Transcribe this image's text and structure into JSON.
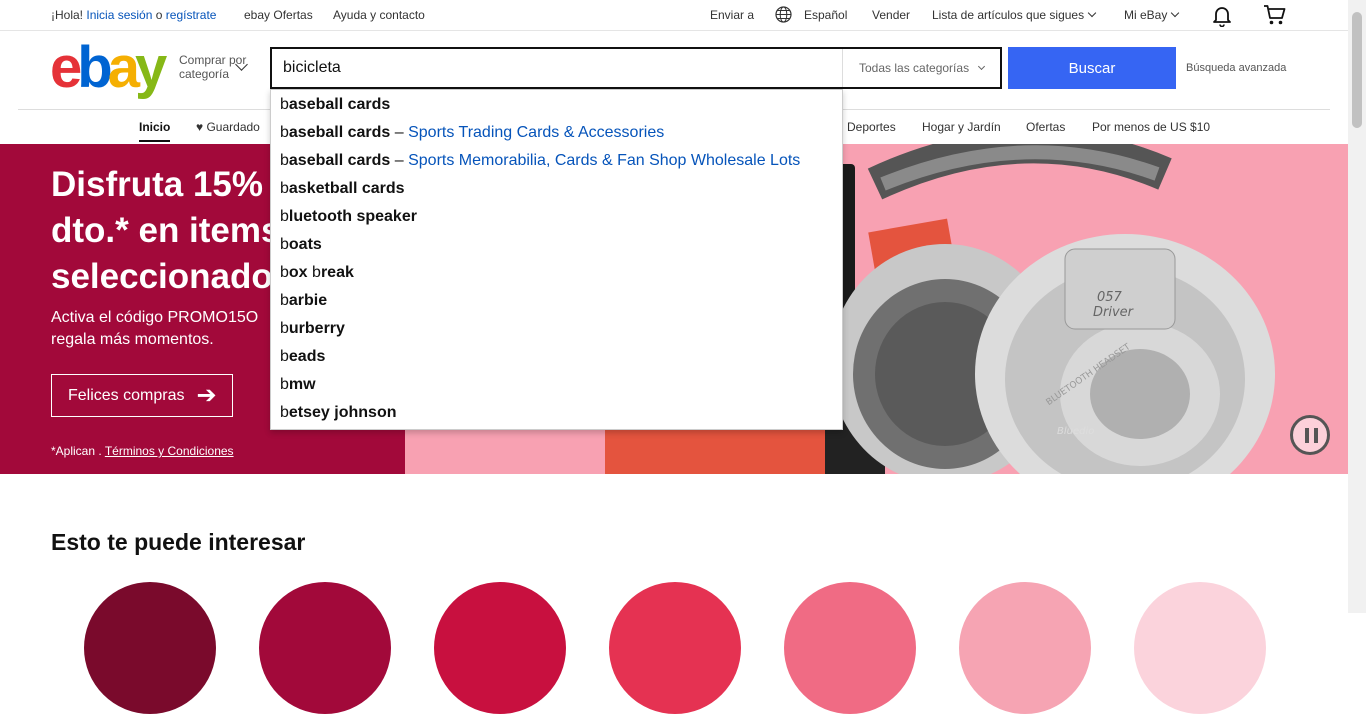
{
  "topbar": {
    "greeting": "¡Hola!",
    "signin": "Inicia sesión",
    "or": "o",
    "register": "regístrate",
    "deals": "ebay Ofertas",
    "help": "Ayuda y contacto",
    "ship_to": "Enviar a",
    "language": "Español",
    "sell": "Vender",
    "watchlist": "Lista de artículos que sigues",
    "my_ebay": "Mi eBay"
  },
  "header": {
    "shop_by_category": [
      "Comprar por",
      "categoría"
    ],
    "search_value": "bicicleta",
    "category_select": "Todas las categorías",
    "search_button": "Buscar",
    "advanced": "Búsqueda avanzada"
  },
  "nav": {
    "home": "Inicio",
    "saved": "Guardado",
    "items": [
      "Deportes",
      "Hogar y Jardín",
      "Ofertas",
      "Por menos de US $10"
    ]
  },
  "suggestions": [
    {
      "prefix": "b",
      "rest": "aseball cards",
      "sep": "",
      "category": ""
    },
    {
      "prefix": "b",
      "rest": "aseball cards",
      "sep": " – ",
      "category": "Sports Trading Cards & Accessories"
    },
    {
      "prefix": "b",
      "rest": "aseball cards",
      "sep": " – ",
      "category": "Sports Memorabilia, Cards & Fan Shop Wholesale Lots"
    },
    {
      "prefix": "b",
      "rest": "asketball cards",
      "sep": "",
      "category": ""
    },
    {
      "prefix": "b",
      "rest": "luetooth speaker",
      "sep": "",
      "category": ""
    },
    {
      "prefix": "b",
      "rest": "oats",
      "sep": "",
      "category": ""
    },
    {
      "prefix": "b",
      "rest": "ox ",
      "rest2_plain": "b",
      "rest3": "reak",
      "sep": "",
      "category": ""
    },
    {
      "prefix": "b",
      "rest": "arbie",
      "sep": "",
      "category": ""
    },
    {
      "prefix": "b",
      "rest": "urberry",
      "sep": "",
      "category": ""
    },
    {
      "prefix": "b",
      "rest": "eads",
      "sep": "",
      "category": ""
    },
    {
      "prefix": "b",
      "rest": "mw",
      "sep": "",
      "category": ""
    },
    {
      "prefix": "b",
      "rest": "etsey johnson",
      "sep": "",
      "category": ""
    }
  ],
  "hero": {
    "title_lines": [
      "Disfruta 15%",
      "dto.* en items",
      "seleccionado"
    ],
    "subtitle_lines": [
      "Activa el código PROMO15O",
      "regala más momentos."
    ],
    "button": "Felices compras",
    "terms_prefix": "*Aplican .",
    "terms_link": "Términos y Condiciones",
    "headphone_text": [
      "057",
      "Driver"
    ],
    "headphone_brand": "Bluedio",
    "headphone_band_text": "BLUETOOTH HEADSET"
  },
  "section": {
    "title": "Esto te puede interesar"
  },
  "colors": {
    "brand_red": "#e53238",
    "brand_blue": "#0064d2",
    "brand_yellow": "#f5af02",
    "brand_green": "#86b817",
    "hero_left": "#a2093a",
    "hero_right": "#f8a1b2",
    "buscar": "#3665f3",
    "link": "#0654ba"
  }
}
